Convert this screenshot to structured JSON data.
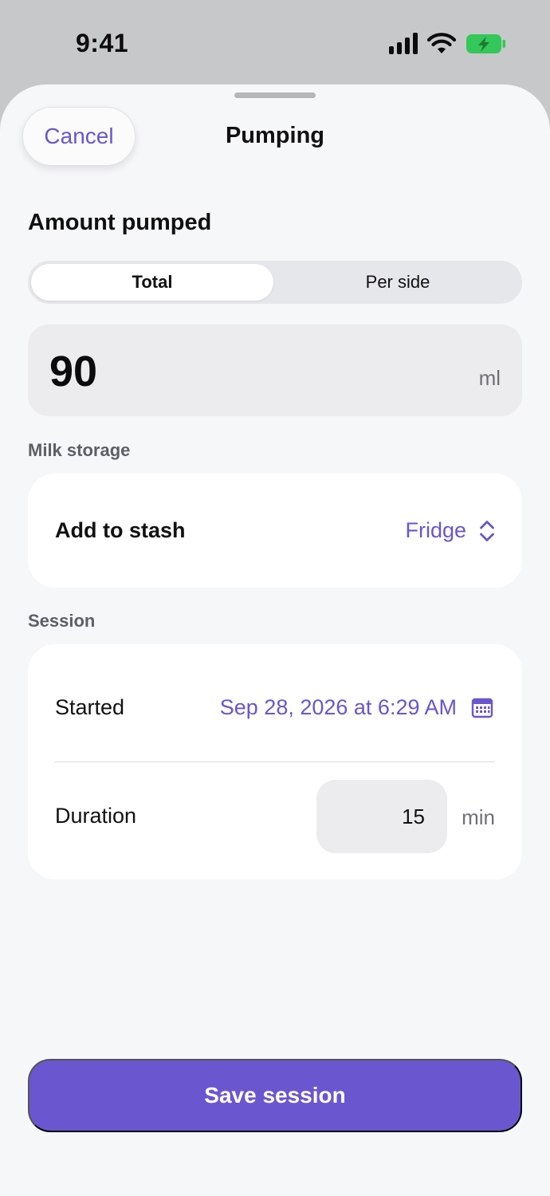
{
  "status_bar": {
    "time": "9:41",
    "icons": [
      "cellular-signal-icon",
      "wifi-icon",
      "battery-charging-icon"
    ],
    "battery_color": "#34c759"
  },
  "header": {
    "cancel_label": "Cancel",
    "title": "Pumping"
  },
  "amount": {
    "heading": "Amount pumped",
    "segments": [
      "Total",
      "Per side"
    ],
    "selected_segment": "Total",
    "value": "90",
    "unit": "ml"
  },
  "milk_storage": {
    "label": "Milk storage",
    "row_label": "Add to stash",
    "selected": "Fridge",
    "icon": "chevron-up-down-icon"
  },
  "session": {
    "label": "Session",
    "started_label": "Started",
    "started_value": "Sep 28, 2026 at 6:29 AM",
    "calendar_icon": "calendar-icon",
    "duration_label": "Duration",
    "duration_value": "15",
    "duration_unit": "min"
  },
  "footer": {
    "save_label": "Save session"
  },
  "colors": {
    "accent": "#6a55cf",
    "save_button": "#6a57d0",
    "sheet_background": "#f6f7f9",
    "backdrop": "#c7c8ca"
  }
}
